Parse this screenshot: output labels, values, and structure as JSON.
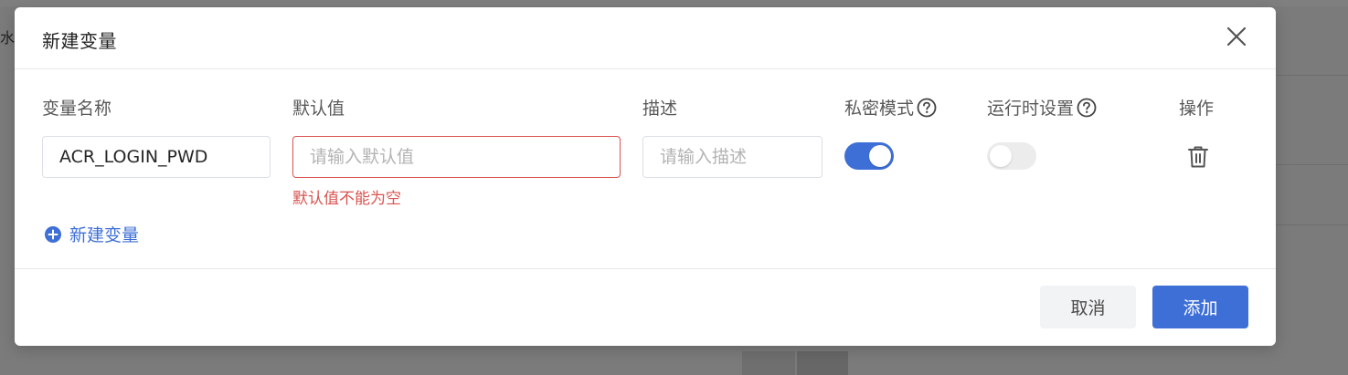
{
  "background": {
    "left_text": "水"
  },
  "dialog": {
    "title": "新建变量",
    "close_icon": "close-icon"
  },
  "columns": {
    "name": "变量名称",
    "default": "默认值",
    "description": "描述",
    "secret": "私密模式",
    "runtime": "运行时设置",
    "actions": "操作"
  },
  "row": {
    "name_value": "ACR_LOGIN_PWD",
    "default_value": "",
    "default_placeholder": "请输入默认值",
    "default_error": "默认值不能为空",
    "description_value": "",
    "description_placeholder": "请输入描述",
    "secret_enabled": true,
    "runtime_enabled": false,
    "delete_icon": "trash-icon"
  },
  "add_variable_label": "新建变量",
  "footer": {
    "cancel_label": "取消",
    "add_label": "添加"
  },
  "colors": {
    "primary": "#3d6fd6",
    "error": "#d9534f",
    "switch_off": "#ececec"
  }
}
